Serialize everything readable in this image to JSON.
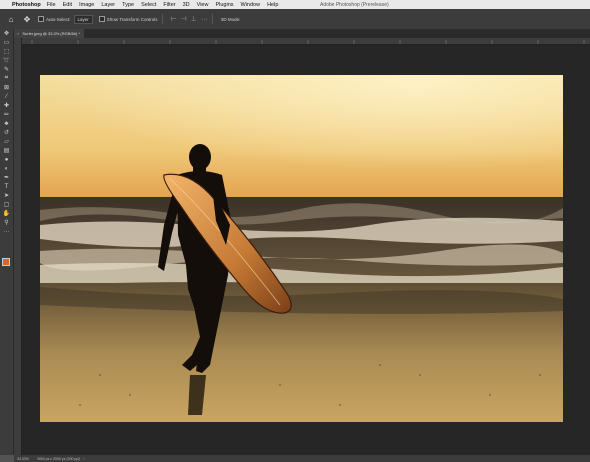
{
  "menubar": {
    "apple_glyph": "",
    "app_name": "Photoshop",
    "items": [
      "File",
      "Edit",
      "Image",
      "Layer",
      "Type",
      "Select",
      "Filter",
      "3D",
      "View",
      "Plugins",
      "Window",
      "Help"
    ],
    "window_title": "Adobe Photoshop (Prerelease)"
  },
  "options": {
    "auto_select_label": "Auto-Select:",
    "auto_select_value": "Layer",
    "transform_label": "Show Transform Controls",
    "mode_label": "3D Mode:"
  },
  "document": {
    "tab_label": "Surfer.jpeg @ 33.3% (RGB/8#) *"
  },
  "status": {
    "zoom": "33.33%",
    "info": "3000 px x 2000 px (300 ppi)"
  },
  "colors": {
    "foreground": "#e0661b",
    "background": "#ffffff"
  },
  "tools": [
    "move-icon",
    "artboard-icon",
    "marquee-icon",
    "lasso-icon",
    "quick-select-icon",
    "crop-icon",
    "frame-icon",
    "eyedropper-icon",
    "healing-icon",
    "brush-icon",
    "clone-stamp-icon",
    "history-brush-icon",
    "eraser-icon",
    "gradient-icon",
    "blur-icon",
    "dodge-icon",
    "pen-icon",
    "type-icon",
    "path-select-icon",
    "rectangle-icon",
    "hand-icon",
    "zoom-icon",
    "more-icon"
  ]
}
